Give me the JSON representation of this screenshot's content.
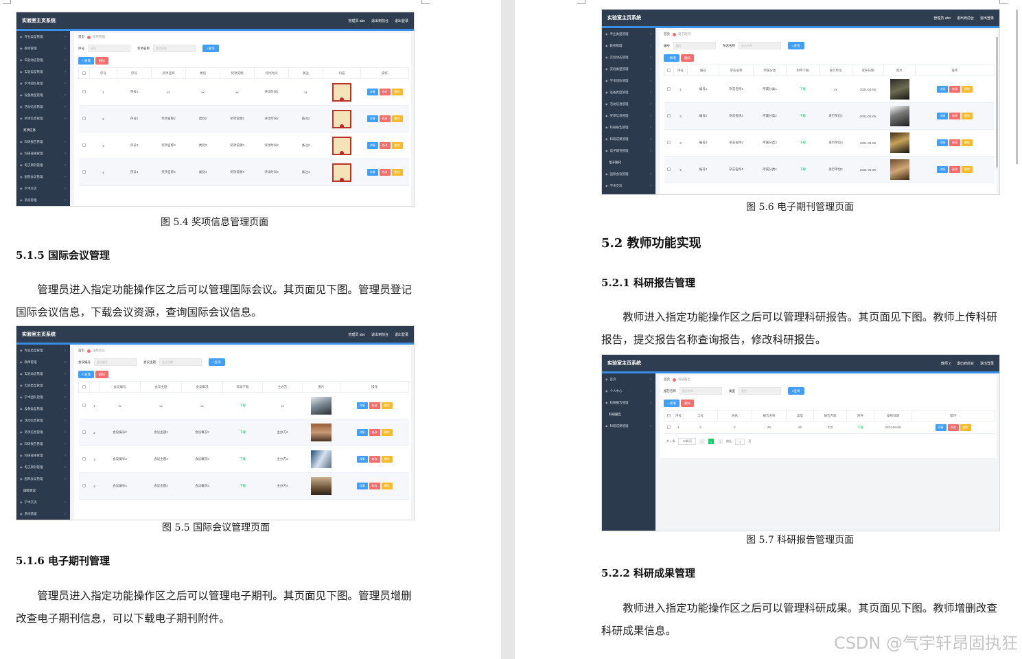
{
  "common": {
    "app_title": "实验室主页系统",
    "crumb_home": "首页",
    "search_button": "查询",
    "add_button": "+ 新增",
    "delete_button": "删除",
    "op_detail": "详情",
    "op_edit": "修改",
    "op_delete": "删除",
    "admin_top": [
      "管理员 abo",
      "退出到前台",
      "退出登录"
    ]
  },
  "shot_award": {
    "crumb": "奖项管理",
    "search": [
      {
        "label": "序号",
        "placeholder": "序号"
      },
      {
        "label": "奖项名称",
        "placeholder": "奖项名称"
      }
    ],
    "sidebar": [
      "专业类型管理",
      "教师管理",
      "实验动态管理",
      "实验类型管理",
      "学术团队管理",
      "设备类型管理",
      "活动信息管理",
      "奖项信息管理",
      "奖项信息",
      "科研报告管理",
      "科研成果管理",
      "电子期刊管理",
      "国际会议管理",
      "学术交流",
      "系统管理"
    ],
    "sub_index": 8,
    "headers": [
      "",
      "序号",
      "序号",
      "奖项名称",
      "类别",
      "奖项说明",
      "评比时间",
      "备注",
      "扫描",
      "操作"
    ],
    "rows": [
      [
        "1",
        "序号1",
        "xx",
        "xx",
        "xx",
        "评比时间1",
        "xx"
      ],
      [
        "2",
        "序号2",
        "奖项名称2",
        "类别2",
        "奖项说明2",
        "评比时间2",
        "备注2"
      ],
      [
        "3",
        "序号3",
        "奖项名称3",
        "类别3",
        "奖项说明3",
        "评比时间3",
        "备注3"
      ],
      [
        "4",
        "序号4",
        "奖项名称4",
        "类别4",
        "奖项说明4",
        "评比时间4",
        "备注4"
      ]
    ]
  },
  "shot_conf": {
    "crumb": "国际会议",
    "search": [
      {
        "label": "会议编号",
        "placeholder": "会议编号"
      },
      {
        "label": "会议主题",
        "placeholder": "会议主题"
      }
    ],
    "sidebar": [
      "专业类型管理",
      "教师管理",
      "实验动态管理",
      "实验类型管理",
      "学术团队管理",
      "设备类型管理",
      "活动信息管理",
      "奖项信息管理",
      "科研报告管理",
      "科研成果管理",
      "电子期刊管理",
      "国际会议管理",
      "国际会议",
      "学术交流",
      "系统管理"
    ],
    "sub_index": 12,
    "headers": [
      "",
      "",
      "会议编号",
      "会议主题",
      "会议概况",
      "资源下载",
      "主办方",
      "图片",
      "操作"
    ],
    "rows": [
      [
        "1",
        "xx",
        "xx",
        "xx",
        "下载",
        "xx"
      ],
      [
        "2",
        "会议编号2",
        "会议主题2",
        "会议概况2",
        "下载",
        "主办方2"
      ],
      [
        "3",
        "会议编号3",
        "会议主题3",
        "会议概况3",
        "下载",
        "主办方3"
      ],
      [
        "4",
        "会议编号4",
        "会议主题4",
        "会议概况4",
        "下载",
        "主办方4"
      ]
    ]
  },
  "shot_journal": {
    "crumb": "电子期刊",
    "search": [
      {
        "label": "编号",
        "placeholder": "编号"
      },
      {
        "label": "杂志名称",
        "placeholder": "杂志名称"
      }
    ],
    "sidebar": [
      "专业类型管理",
      "教师管理",
      "实验动态管理",
      "实验类型管理",
      "学术团队管理",
      "设备类型管理",
      "活动信息管理",
      "奖项信息管理",
      "科研报告管理",
      "科研成果管理",
      "电子期刊管理",
      "电子期刊",
      "国际会议管理",
      "学术交流"
    ],
    "sub_index": 11,
    "headers": [
      "",
      "序号",
      "编号",
      "杂志名称",
      "所属分类",
      "附件下载",
      "发行单位",
      "发布日期",
      "图片",
      "操作"
    ],
    "rows": [
      [
        "1",
        "编号1",
        "杂志名称1",
        "所属分类1",
        "下载",
        "xx",
        "2021-04-05"
      ],
      [
        "2",
        "编号2",
        "杂志名称2",
        "所属分类2",
        "下载",
        "发行单位2",
        "2021-04-05"
      ],
      [
        "3",
        "编号3",
        "杂志名称3",
        "所属分类3",
        "下载",
        "发行单位3",
        "2021-04-05"
      ],
      [
        "4",
        "编号4",
        "杂志名称4",
        "所属分类4",
        "下载",
        "发行单位4",
        "2021-04-05"
      ]
    ]
  },
  "shot_report": {
    "crumb": "科研报告",
    "teacher_top": [
      "教师 2",
      "退出到前台",
      "退出登录"
    ],
    "search": [
      {
        "label": "报告名称",
        "placeholder": "报告名称"
      },
      {
        "label": "类型",
        "placeholder": "类型"
      }
    ],
    "sidebar": [
      "首页",
      "个人中心",
      "科研报告管理",
      "科研报告",
      "科研成果管理"
    ],
    "sub_index": 3,
    "headers": [
      "",
      "序号",
      "工号",
      "姓名",
      "报告名称",
      "类型",
      "报告内容",
      "附件",
      "发布日期",
      "操作"
    ],
    "rows": [
      [
        "1",
        "2",
        "2",
        "22",
        "22",
        "222",
        "下载",
        "2021-04-06"
      ]
    ],
    "pager": [
      "共 1 条",
      "10条/页",
      "前往",
      "1",
      "页"
    ]
  },
  "doc": {
    "fig54": "图 5.4  奖项信息管理页面",
    "h515": "5.1.5   国际会议管理",
    "p515": "管理员进入指定功能操作区之后可以管理国际会议。其页面见下图。管理员登记国际会议信息，下载会议资源，查询国际会议信息。",
    "fig55": "图 5.5 国际会议管理页面",
    "h516": "5.1.6   电子期刊管理",
    "p516": "管理员进入指定功能操作区之后可以管理电子期刊。其页面见下图。管理员增删改查电子期刊信息，可以下载电子期刊附件。",
    "fig56": "图 5.6  电子期刊管理页面",
    "h52": "5.2   教师功能实现",
    "h521": "5.2.1   科研报告管理",
    "p521": "教师进入指定功能操作区之后可以管理科研报告。其页面见下图。教师上传科研报告，提交报告名称查询报告，修改科研报告。",
    "fig57": "图 5.7  科研报告管理页面",
    "h522": "5.2.2   科研成果管理",
    "p522": "教师进入指定功能操作区之后可以管理科研成果。其页面见下图。教师增删改查科研成果信息。",
    "watermark": "CSDN @气宇轩昂固执狂"
  }
}
